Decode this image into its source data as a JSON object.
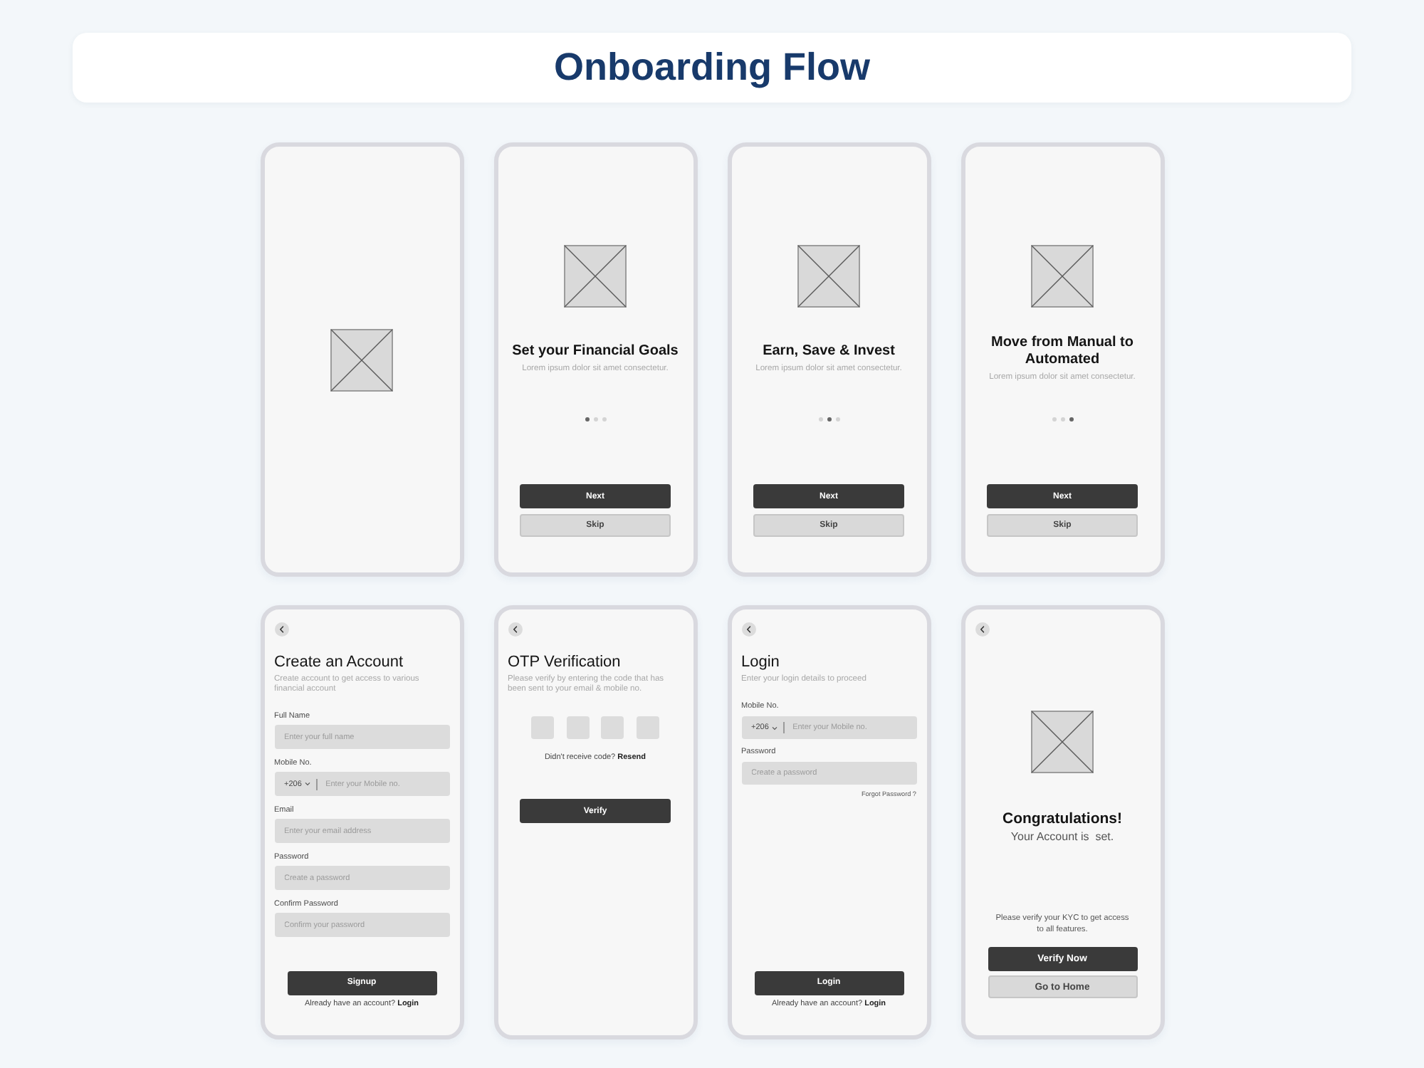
{
  "header": {
    "title": "Onboarding Flow"
  },
  "screens": [
    {
      "kind": "splash",
      "image": {
        "kind": "placeholder"
      }
    },
    {
      "kind": "intro",
      "image": {
        "kind": "placeholder"
      },
      "title": "Set your Financial Goals",
      "subtitle": "Lorem ipsum dolor sit amet consectetur.",
      "dots": [
        {
          "selected": true
        },
        {
          "selected": false
        },
        {
          "selected": false
        }
      ],
      "buttons": [
        {
          "kind": "primary",
          "label": "Next"
        },
        {
          "kind": "secondary",
          "label": "Skip"
        }
      ]
    },
    {
      "kind": "intro",
      "image": {
        "kind": "placeholder"
      },
      "title": "Earn, Save & Invest",
      "subtitle": "Lorem ipsum dolor sit amet consectetur.",
      "dots": [
        {
          "selected": false
        },
        {
          "selected": true
        },
        {
          "selected": false
        }
      ],
      "buttons": [
        {
          "kind": "primary",
          "label": "Next"
        },
        {
          "kind": "secondary",
          "label": "Skip"
        }
      ]
    },
    {
      "kind": "intro",
      "image": {
        "kind": "placeholder"
      },
      "title": "Move from Manual to Automated",
      "subtitle": "Lorem ipsum dolor sit amet consectetur.",
      "dots": [
        {
          "selected": false
        },
        {
          "selected": false
        },
        {
          "selected": true
        }
      ],
      "buttons": [
        {
          "kind": "primary",
          "label": "Next"
        },
        {
          "kind": "secondary",
          "label": "Skip"
        }
      ]
    },
    {
      "kind": "signup",
      "title": "Create an Account",
      "subtitle": "Create account to get access to various financial account",
      "fields": [
        {
          "kind": "text",
          "label": "Full Name",
          "placeholder": "Enter your full name"
        },
        {
          "kind": "phone",
          "label": "Mobile No.",
          "country_code": "+206",
          "placeholder": "Enter your Mobile no."
        },
        {
          "kind": "text",
          "label": "Email",
          "placeholder": "Enter your email address"
        },
        {
          "kind": "text",
          "label": "Password",
          "placeholder": "Create a password"
        },
        {
          "kind": "text",
          "label": "Confirm Password",
          "placeholder": "Confirm your password"
        }
      ],
      "buttons": [
        {
          "kind": "primary",
          "label": "Signup"
        }
      ],
      "footer": {
        "text": "Already have an account?",
        "link": "Login"
      }
    },
    {
      "kind": "otp",
      "title": "OTP Verification",
      "subtitle": "Please verify by entering the code that has been sent to your email & mobile no.",
      "code_fields": [
        {
          "kind": "digit"
        },
        {
          "kind": "digit"
        },
        {
          "kind": "digit"
        },
        {
          "kind": "digit"
        }
      ],
      "resend": {
        "text": "Didn't receive code?",
        "link": "Resend"
      },
      "buttons": [
        {
          "kind": "primary",
          "label": "Verify"
        }
      ]
    },
    {
      "kind": "login",
      "title": "Login",
      "subtitle": "Enter your login details to proceed",
      "fields": [
        {
          "kind": "phone",
          "label": "Mobile No.",
          "country_code": "+206",
          "placeholder": "Enter your Mobile no."
        },
        {
          "kind": "text",
          "label": "Password",
          "placeholder": "Create a password"
        }
      ],
      "forgot_link": "Forgot Password ?",
      "buttons": [
        {
          "kind": "primary",
          "label": "Login"
        }
      ],
      "footer": {
        "text": "Already have an account?",
        "link": "Login"
      }
    },
    {
      "kind": "success",
      "image": {
        "kind": "placeholder"
      },
      "title": "Congratulations!",
      "message": "Your Account is  set.",
      "note": "Please verify your KYC to get access to all features.",
      "buttons": [
        {
          "kind": "primary",
          "label": "Verify Now"
        },
        {
          "kind": "secondary",
          "label": "Go to Home"
        }
      ]
    }
  ]
}
